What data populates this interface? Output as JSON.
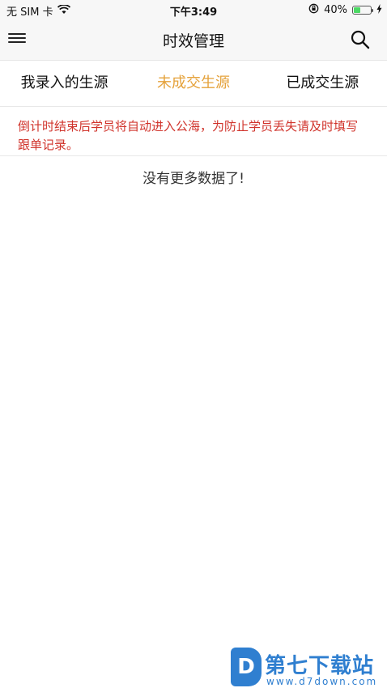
{
  "status_bar": {
    "carrier": "无 SIM 卡",
    "time": "下午3:49",
    "battery_percent": "40%",
    "battery_level": 0.4,
    "icons": [
      "wifi-icon",
      "orientation-lock-icon",
      "battery-icon",
      "charging-icon"
    ]
  },
  "nav": {
    "title": "时效管理",
    "left_icon": "menu-icon",
    "right_icon": "search-icon"
  },
  "tabs": [
    {
      "label": "我录入的生源",
      "active": false
    },
    {
      "label": "未成交生源",
      "active": true
    },
    {
      "label": "已成交生源",
      "active": false
    }
  ],
  "notice": "倒计时结束后学员将自动进入公海，为防止学员丢失请及时填写跟单记录。",
  "empty_message": "没有更多数据了!",
  "watermark": {
    "logo_letter": "D",
    "title": "第七下载站",
    "url": "www.d7down.com"
  },
  "colors": {
    "active_tab": "#e5a23b",
    "notice": "#d0332b",
    "watermark": "#2f7fd0",
    "battery": "#4cd964"
  }
}
